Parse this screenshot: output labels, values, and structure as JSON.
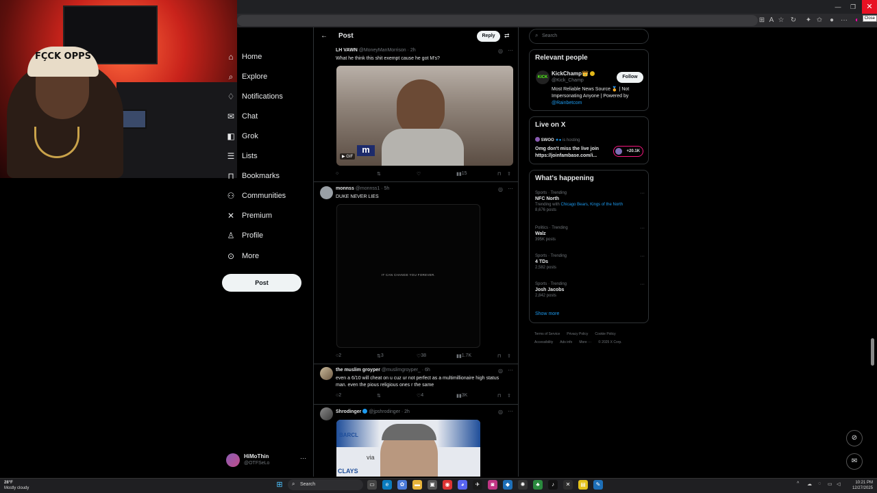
{
  "browser": {
    "close_tooltip": "Close"
  },
  "webcam": {
    "cap_text": "FÇCK OPPS"
  },
  "nav": {
    "items": [
      {
        "label": "Home",
        "icon": "home-icon"
      },
      {
        "label": "Explore",
        "icon": "search-icon"
      },
      {
        "label": "Notifications",
        "icon": "bell-icon"
      },
      {
        "label": "Chat",
        "icon": "chat-icon"
      },
      {
        "label": "Grok",
        "icon": "grok-icon"
      },
      {
        "label": "Lists",
        "icon": "list-icon"
      },
      {
        "label": "Bookmarks",
        "icon": "bookmark-icon"
      },
      {
        "label": "Communities",
        "icon": "people-icon"
      },
      {
        "label": "Premium",
        "icon": "x-logo-icon"
      },
      {
        "label": "Profile",
        "icon": "person-icon"
      },
      {
        "label": "More",
        "icon": "more-circle-icon"
      }
    ],
    "post_button": "Post",
    "account_name": "HiMoThin",
    "account_handle": "@OTFSeLo"
  },
  "post_header": {
    "title": "Post",
    "reply_button": "Reply"
  },
  "tweets": [
    {
      "name": "LH VAWN",
      "handle": "@MoneyManMorrison · 2h",
      "text": "What he think this shit exempt cause he got M's?",
      "media_badge": "GIF",
      "media_logo": "m",
      "replies": "",
      "retweets": "",
      "likes": "",
      "views": "15"
    },
    {
      "name": "monnss",
      "handle": "@monnss1 · 5h",
      "text": "DUKE NEVER LIES",
      "media_caption": "IT CAN CHANGE YOU FOREVER.",
      "replies": "2",
      "retweets": "3",
      "likes": "38",
      "views": "1.7K"
    },
    {
      "name": "the muslim groyper",
      "handle": "@muslimgroyper_ · 6h",
      "text": "even a 6/10 will cheat on u cuz ur not perfect as a multimillionaire high status man. even the pious religious ones r the same",
      "replies": "2",
      "retweets": "",
      "likes": "4",
      "views": "3K"
    },
    {
      "name": "Shrodinger",
      "handle": "@jpshrodinger · 2h",
      "text": "",
      "media_sponsor_1": "BARCL",
      "media_sponsor_2": "CLAYS",
      "media_sponsor_3": "via"
    }
  ],
  "right": {
    "search_placeholder": "Search",
    "relevant_title": "Relevant people",
    "person_name": "KickChamp👑",
    "person_handle": "@Kick_Champ",
    "person_bio": "Most Reliable News Source 🏅 | Not Impersonating Anyone | Powered by",
    "person_bio_link": "@Rainbetcom",
    "follow_button": "Follow",
    "live_title": "Live on X",
    "live_host": "SWOO",
    "live_status": "is hosting",
    "live_text": "Omg don't miss the live join https://joinfambase.com/i...",
    "live_count": "+20.1K",
    "happening_title": "What's happening",
    "trends": [
      {
        "category": "Sports · Trending",
        "title": "NFC North",
        "meta_prefix": "Trending with",
        "meta_link": "Chicago Bears, Kings of the North",
        "count": "8,676 posts"
      },
      {
        "category": "Politics · Trending",
        "title": "Walz",
        "count": "395K posts"
      },
      {
        "category": "Sports · Trending",
        "title": "4 TDs",
        "count": "2,582 posts"
      },
      {
        "category": "Sports · Trending",
        "title": "Josh Jacobs",
        "count": "2,842 posts"
      }
    ],
    "show_more": "Show more",
    "footer": [
      "Terms of Service",
      "Privacy Policy",
      "Cookie Policy",
      "Accessibility",
      "Ads info",
      "More ···",
      "© 2025 X Corp."
    ]
  },
  "taskbar": {
    "temp": "28°F",
    "weather": "Mostly cloudy",
    "search_placeholder": "Search",
    "time": "10:21 PM",
    "date": "12/27/2025"
  }
}
